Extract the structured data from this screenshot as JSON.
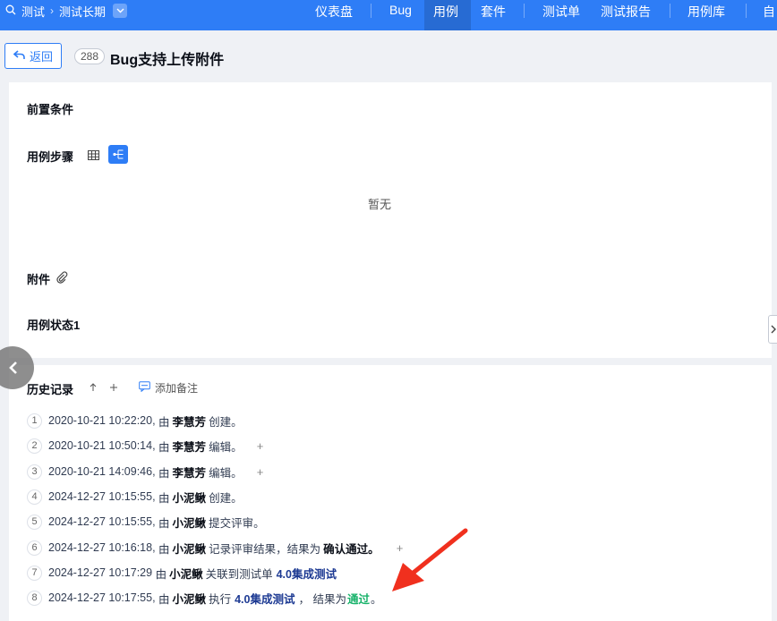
{
  "breadcrumb": {
    "project": "测试",
    "sub": "测试长期"
  },
  "nav": [
    {
      "label": "仪表盘"
    },
    {
      "label": "Bug"
    },
    {
      "label": "用例",
      "active": true
    },
    {
      "label": "套件"
    },
    {
      "label": "测试单"
    },
    {
      "label": "测试报告"
    },
    {
      "label": "用例库"
    },
    {
      "label": "自"
    }
  ],
  "header": {
    "back_label": "返回",
    "case_id": "288",
    "title": "Bug支持上传附件"
  },
  "sections": {
    "precondition": "前置条件",
    "steps": "用例步骤",
    "empty": "暂无",
    "attachments": "附件",
    "status": "用例状态1"
  },
  "history": {
    "title": "历史记录",
    "add_note": "添加备注",
    "entries": [
      {
        "num": "1",
        "time": "2020-10-21 10:22:20,",
        "by": "由",
        "user": "李慧芳",
        "action": "创建。"
      },
      {
        "num": "2",
        "time": "2020-10-21 10:50:14,",
        "by": "由",
        "user": "李慧芳",
        "action": "编辑。"
      },
      {
        "num": "3",
        "time": "2020-10-21 14:09:46,",
        "by": "由",
        "user": "李慧芳",
        "action": "编辑。"
      },
      {
        "num": "4",
        "time": "2024-12-27 10:15:55,",
        "by": "由",
        "user": "小泥鳅",
        "action": "创建。"
      },
      {
        "num": "5",
        "time": "2024-12-27 10:15:55,",
        "by": "由",
        "user": "小泥鳅",
        "action": "提交评审。"
      },
      {
        "num": "6",
        "time": "2024-12-27 10:16:18,",
        "by": "由",
        "user": "小泥鳅",
        "action": "记录评审结果，结果为",
        "result": "确认通过。"
      },
      {
        "num": "7",
        "time": "2024-12-27 10:17:29",
        "by": "由",
        "user": "小泥鳅",
        "action": "关联到测试单",
        "link": "4.0集成测试"
      },
      {
        "num": "8",
        "time": "2024-12-27 10:17:55,",
        "by": "由",
        "user": "小泥鳅",
        "action": "执行",
        "link": "4.0集成测试",
        "action2": "，  结果为",
        "pass": "通过",
        "end": "。"
      }
    ]
  },
  "colors": {
    "primary": "#2e7df6",
    "link": "#1d3a93",
    "pass": "#17b26a",
    "arrow": "#f0301e"
  }
}
